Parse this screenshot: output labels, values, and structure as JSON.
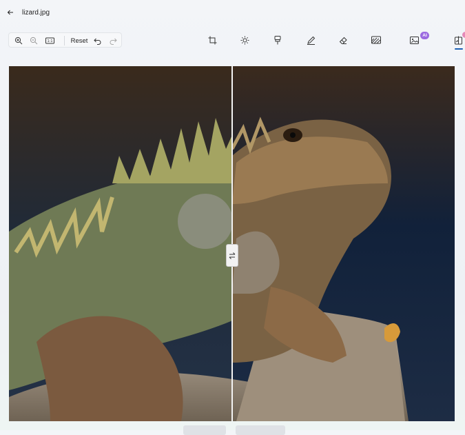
{
  "header": {
    "back_icon": "arrow-left-icon",
    "file_name": "lizard.jpg"
  },
  "view_tools": {
    "zoom_in_icon": "zoom-in-icon",
    "zoom_out_icon": "zoom-out-icon",
    "actual_size_icon": "actual-size-icon",
    "reset_label": "Reset",
    "undo_icon": "undo-icon",
    "redo_icon": "redo-icon"
  },
  "edit_tools": [
    {
      "name": "crop",
      "icon": "crop-icon"
    },
    {
      "name": "adjustment",
      "icon": "brightness-icon"
    },
    {
      "name": "filter",
      "icon": "filter-icon"
    },
    {
      "name": "markup",
      "icon": "pen-icon"
    },
    {
      "name": "erase",
      "icon": "eraser-icon"
    },
    {
      "name": "background",
      "icon": "background-icon"
    },
    {
      "name": "generative",
      "icon": "ai-image-icon",
      "badge": "AI"
    },
    {
      "name": "compare",
      "icon": "compare-icon",
      "active": true
    }
  ],
  "compare": {
    "handle_icon": "swap-arrows-icon"
  },
  "colors": {
    "accent": "#1a5fb4",
    "ai_badge": "#9b6ae0"
  }
}
